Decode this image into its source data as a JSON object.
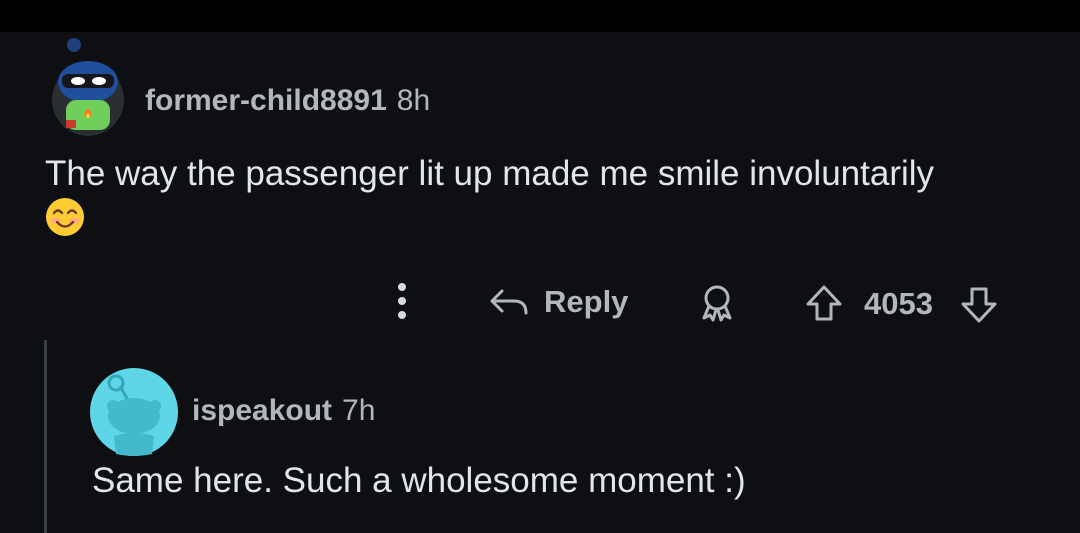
{
  "comment": {
    "author": "former-child8891",
    "time": "8h",
    "body": "The way the passenger lit up made me smile involuntarily",
    "emoji": "smiling-face-with-smiling-eyes"
  },
  "actions": {
    "reply_label": "Reply",
    "vote_count": "4053"
  },
  "reply": {
    "author": "ispeakout",
    "time": "7h",
    "body": "Same here. Such a wholesome moment :)"
  },
  "colors": {
    "background": "#0e0f12",
    "topbar": "#000000",
    "meta_text": "#b4b7ba",
    "body_text": "#e3e6e8",
    "reply_avatar_bg": "#5ed6e8"
  }
}
